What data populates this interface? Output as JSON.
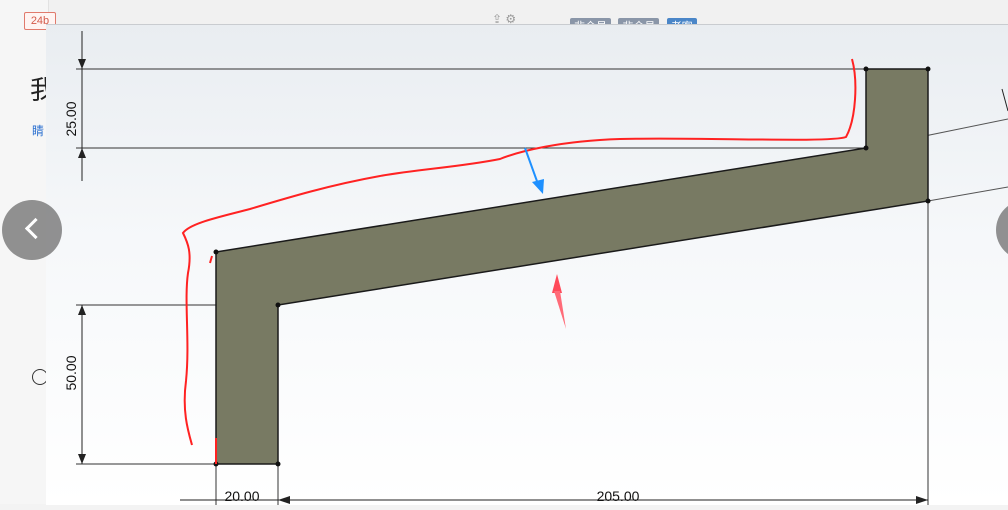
{
  "background_page": {
    "tag": "24b",
    "heading_char": "我",
    "link_text": "睛",
    "top_chips": [
      {
        "label": "非会员",
        "color": "#8a96a8"
      },
      {
        "label": "非会员",
        "color": "#8a96a8"
      },
      {
        "label": "老客",
        "color": "#4a86c8"
      }
    ]
  },
  "viewer": {
    "prev_button": "previous-image",
    "next_button": "next-image"
  },
  "sketch": {
    "fill_color": "#787a63",
    "dimensions": {
      "top_vertical": "25.00",
      "bottom_vertical": "50.00",
      "bottom_left": "20.00",
      "bottom_total": "205.00"
    },
    "annotation_colors": {
      "outline": "#ff2222",
      "arrow_top": "#1e90ff",
      "arrow_bottom": "#ff4a5a"
    }
  }
}
